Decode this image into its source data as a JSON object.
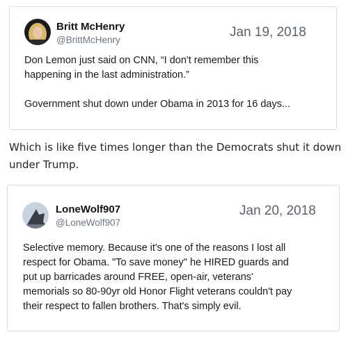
{
  "tweet1": {
    "author_name": "Britt McHenry",
    "handle": "@BrittMcHenry",
    "date": "Jan 19, 2018",
    "text": "Don Lemon just said on CNN, “I don't remember this\nhappening in the last administration.”\n\nGovernment shut down under Obama in 2013 for 16 days..."
  },
  "comment": {
    "text": "Which is like five times longer than the Democrats shut it down under Trump."
  },
  "tweet2": {
    "author_name": "LoneWolf907",
    "handle": "@LoneWolf907",
    "date": "Jan 20, 2018",
    "text": "Selective memory. Because it's one of the reasons I lost all\nrespect for Obama. \"To save money\" he HIRED guards and\nput up barricades around FREE, open-air, veterans'\nmemorials so 80-90yr old Honor Flight veterans couldn't pay\ntheir respect to fallen brothers. That's simply evil."
  }
}
